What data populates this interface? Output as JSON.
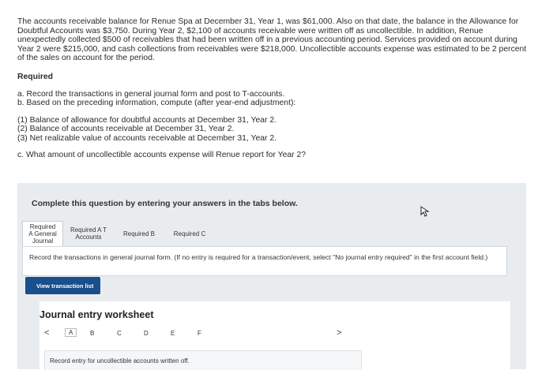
{
  "problem": {
    "paragraph": "The accounts receivable balance for Renue Spa at December 31, Year 1, was $61,000. Also on that date, the balance in the Allowance for Doubtful Accounts was $3,750. During Year 2, $2,100 of accounts receivable were written off as uncollectible. In addition, Renue unexpectedly collected $500 of receivables that had been written off in a previous accounting period. Services provided on account during Year 2 were $215,000, and cash collections from receivables were $218,000. Uncollectible accounts expense was estimated to be 2 percent of the sales on account for the period.",
    "required_heading": "Required",
    "task_a": "a. Record the transactions in general journal form and post to T-accounts.",
    "task_b": "b. Based on the preceding information, compute (after year-end adjustment):",
    "sub_items": [
      "(1) Balance of allowance for doubtful accounts at December 31, Year 2.",
      "(2) Balance of accounts receivable at December 31, Year 2.",
      "(3) Net realizable value of accounts receivable at December 31, Year 2."
    ],
    "task_c": "c. What amount of uncollectible accounts expense will Renue report for Year 2?"
  },
  "panel": {
    "title": "Complete this question by entering your answers in the tabs below."
  },
  "tabs": [
    {
      "label": "Required A General Journal"
    },
    {
      "label": "Required A T Accounts"
    },
    {
      "label": "Required B"
    },
    {
      "label": "Required C"
    }
  ],
  "instruction": "Record the transactions in general journal form. (If no entry is required for a transaction/event, select \"No journal entry required\" in the first account field.)",
  "view_button": "View transaction list",
  "worksheet": {
    "title": "Journal entry worksheet",
    "nav_letters": [
      "A",
      "B",
      "C",
      "D",
      "E",
      "F"
    ],
    "prev_glyph": "<",
    "next_glyph": ">",
    "record_text": "Record entry for uncollectible accounts written off."
  }
}
